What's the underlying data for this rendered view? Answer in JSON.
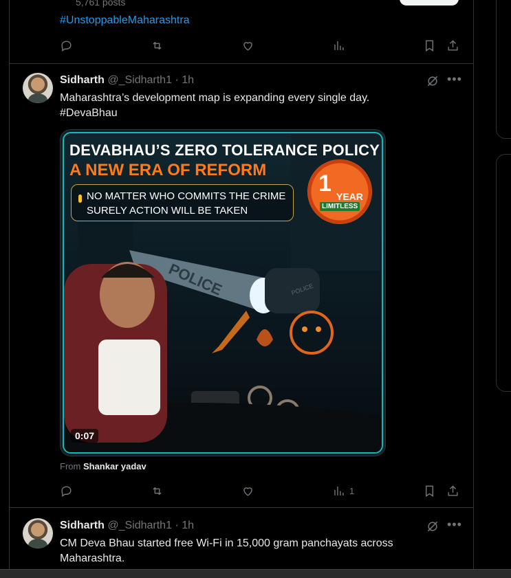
{
  "top_fragment": {
    "posts_count": "5,761 posts",
    "hashtag": "#UnstoppableMaharashtra"
  },
  "tweet1": {
    "name": "Sidharth",
    "handle": "@_Sidharth1",
    "time": "· 1h",
    "text": "Maharashtra’s development map is expanding every single day.",
    "hashtag": "#DevaBhau",
    "media": {
      "title_line1": "DEVABHAU’S ZERO TOLERANCE POLICY",
      "title_line2": "A NEW ERA OF REFORM",
      "note_line1": "NO MATTER WHO COMMITS THE CRIME",
      "note_line2": "SURELY ACTION WILL BE TAKEN",
      "badge_number": "1",
      "badge_year": "YEAR",
      "badge_limitless": "LIMITLESS",
      "police_text": "POLICE",
      "police_small": "POLICE",
      "video_time": "0:07"
    },
    "from_prefix": "From",
    "from_name": "Shankar yadav",
    "views_count": "1"
  },
  "tweet2": {
    "name": "Sidharth",
    "handle": "@_Sidharth1",
    "time": "· 1h",
    "text_line1": "CM Deva Bhau started free Wi-Fi in 15,000 gram panchayats across",
    "text_line2": "Maharashtra."
  },
  "colors": {
    "accent": "#1d9bf0",
    "muted": "#71767b",
    "text": "#e7e9ea",
    "border": "#2f3336",
    "orange": "#ff7a1a"
  }
}
